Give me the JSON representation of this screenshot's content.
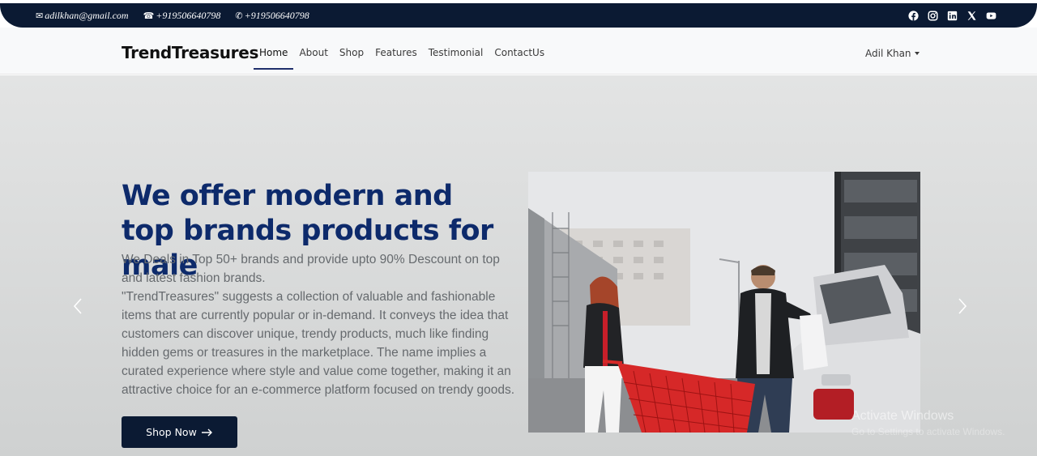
{
  "topbar": {
    "email": "adilkhan@gmail.com",
    "phone": "+919506640798",
    "whatsapp": "+919506640798",
    "socials": [
      "facebook-icon",
      "instagram-icon",
      "linkedin-icon",
      "x-icon",
      "youtube-icon"
    ]
  },
  "navbar": {
    "brand": "TrendTreasures",
    "links": [
      "Home",
      "About",
      "Shop",
      "Features",
      "Testimonial",
      "ContactUs"
    ],
    "active": "Home",
    "user": "Adil Khan"
  },
  "hero": {
    "title": "We offer modern and top brands products for male",
    "paragraph1": "We Deals in Top 50+ brands and provide upto 90% Descount on top and latest fashion brands.",
    "paragraph2": "\"TrendTreasures\" suggests a collection of valuable and fashionable items that are currently popular or in-demand. It conveys the idea that customers can discover unique, trendy products, much like finding hidden gems or treasures in the marketplace. The name implies a curated experience where style and value come together, making it an attractive choice for an e-commerce platform focused on trendy goods.",
    "button": "Shop Now"
  },
  "watermark": {
    "title": "Activate Windows",
    "subtitle": "Go to Settings to activate Windows."
  },
  "colors": {
    "topbar": "#0b1a33",
    "title": "#0d2a6b",
    "button": "#0b1a33",
    "cart": "#d62828"
  }
}
